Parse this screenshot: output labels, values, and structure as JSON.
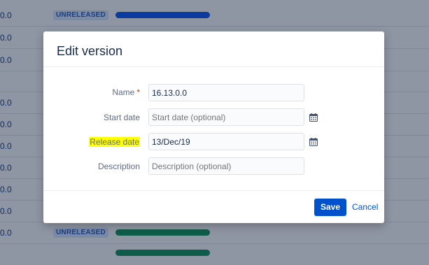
{
  "background": {
    "rows": [
      {
        "version": "0.0",
        "status": "UNRELEASED",
        "bar_color": "#0b3b9e"
      },
      {
        "version": "0.0",
        "status": "",
        "bar_color": ""
      },
      {
        "version": "0.0",
        "status": "",
        "bar_color": ""
      },
      {
        "version": "",
        "status": "",
        "bar_color": ""
      },
      {
        "version": "0.0",
        "status": "",
        "bar_color": ""
      },
      {
        "version": "0.0",
        "status": "",
        "bar_color": ""
      },
      {
        "version": "0.0",
        "status": "",
        "bar_color": ""
      },
      {
        "version": "0.0",
        "status": "",
        "bar_color": ""
      },
      {
        "version": "0.0",
        "status": "",
        "bar_color": ""
      },
      {
        "version": "0.0",
        "status": "",
        "bar_color": ""
      },
      {
        "version": "0.0",
        "status": "UNRELEASED",
        "bar_color": "#0f5c4a"
      }
    ]
  },
  "dialog": {
    "title": "Edit version",
    "fields": {
      "name": {
        "label": "Name",
        "required_mark": "*",
        "value": "16.13.0.0"
      },
      "start_date": {
        "label": "Start date",
        "value": "",
        "placeholder": "Start date (optional)",
        "icon": "calendar-icon"
      },
      "release_date": {
        "label": "Release date",
        "value": "13/Dec/19",
        "icon": "calendar-icon",
        "highlight_color": "#ffff00"
      },
      "description": {
        "label": "Description",
        "value": "",
        "placeholder": "Description (optional)"
      }
    },
    "save_label": "Save",
    "cancel_label": "Cancel"
  },
  "colors": {
    "primary": "#0052cc",
    "required": "#de350b",
    "overlay": "#8e95a3"
  }
}
